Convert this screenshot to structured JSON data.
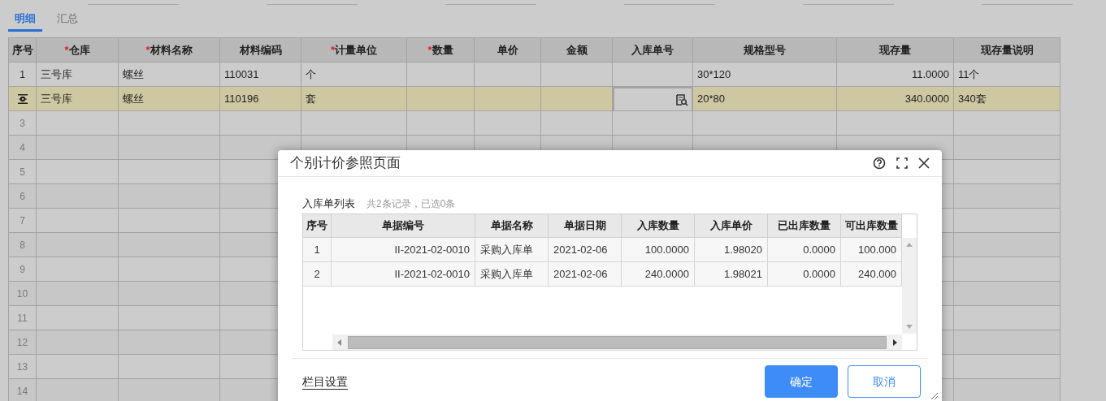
{
  "tabs": [
    {
      "label": "明细",
      "selected": true
    },
    {
      "label": "汇总",
      "selected": false
    }
  ],
  "table": {
    "columns": [
      {
        "label": "序号"
      },
      {
        "label": "仓库",
        "required_mark": "*"
      },
      {
        "label": "材料名称",
        "required_mark": "*"
      },
      {
        "label": "材料编码"
      },
      {
        "label": "计量单位",
        "required_mark": "*"
      },
      {
        "label": "数量",
        "required_mark": "*"
      },
      {
        "label": "单价"
      },
      {
        "label": "金额"
      },
      {
        "label": "入库单号"
      },
      {
        "label": "规格型号"
      },
      {
        "label": "现存量"
      },
      {
        "label": "现存量说明"
      }
    ],
    "rows": [
      {
        "seq": "1",
        "selected": false,
        "cells": [
          {
            "text": "三号库",
            "focused": false
          },
          {
            "text": "螺丝",
            "focused": false
          },
          {
            "text": "110031",
            "focused": false
          },
          {
            "text": "个",
            "focused": false
          },
          {
            "focused": false
          },
          {
            "focused": false
          },
          {
            "focused": false
          },
          {
            "focused": false
          },
          {
            "text": "30*120",
            "focused": false
          },
          {
            "text": "11.0000",
            "focused": false
          },
          {
            "text": "11个",
            "focused": false
          }
        ]
      },
      {
        "selected": true,
        "cells": [
          {
            "text": "三号库",
            "focused": false
          },
          {
            "text": "螺丝",
            "focused": false
          },
          {
            "text": "110196",
            "focused": false
          },
          {
            "text": "套",
            "focused": false
          },
          {
            "focused": false
          },
          {
            "focused": false
          },
          {
            "focused": false
          },
          {
            "focused": true
          },
          {
            "text": "20*80",
            "focused": false
          },
          {
            "text": "340.0000",
            "focused": false
          },
          {
            "text": "340套",
            "focused": false
          }
        ]
      },
      {
        "seq": "3",
        "selected": false
      },
      {
        "seq": "4",
        "selected": false
      },
      {
        "seq": "5",
        "selected": false
      },
      {
        "seq": "6",
        "selected": false
      },
      {
        "seq": "7",
        "selected": false
      },
      {
        "seq": "8",
        "selected": false
      },
      {
        "seq": "9",
        "selected": false
      },
      {
        "seq": "10",
        "selected": false
      },
      {
        "seq": "11",
        "selected": false
      },
      {
        "seq": "12",
        "selected": false
      },
      {
        "seq": "13",
        "selected": false
      },
      {
        "seq": "14",
        "selected": false
      }
    ]
  },
  "dialog": {
    "title": "个别计价参照页面",
    "list_title": "入库单列表",
    "record_count": "共2条记录，已选0条",
    "columns": [
      "序号",
      "单据编号",
      "单据名称",
      "单据日期",
      "入库数量",
      "入库单价",
      "已出库数量",
      "可出库数量"
    ],
    "rows": [
      [
        "1",
        "II-2021-02-0010",
        "采购入库单",
        "2021-02-06",
        "100.0000",
        "1.98020",
        "0.0000",
        "100.000"
      ],
      [
        "2",
        "II-2021-02-0010",
        "采购入库单",
        "2021-02-06",
        "240.0000",
        "1.98021",
        "0.0000",
        "240.000"
      ]
    ],
    "column_settings_link": "栏目设置",
    "buttons": [
      {
        "label": "确定",
        "kind": "primary"
      },
      {
        "label": "取消",
        "kind": "secondary"
      }
    ]
  }
}
